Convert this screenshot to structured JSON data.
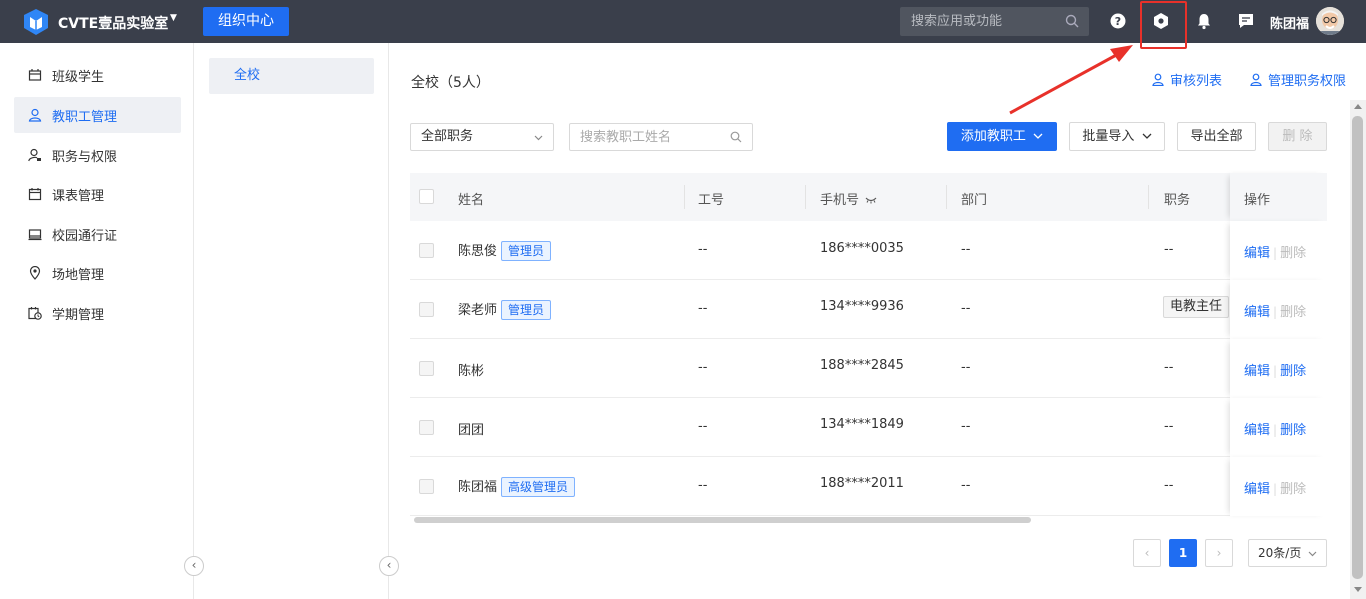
{
  "topbar": {
    "app_title": "CVTE壹品实验室",
    "org_button": "组织中心",
    "search_placeholder": "搜索应用或功能",
    "username": "陈团福",
    "bg_color": "#3a3f4b",
    "accent": "#1f6df2"
  },
  "sidenav": {
    "items": [
      {
        "label": "班级学生",
        "icon": "class-icon"
      },
      {
        "label": "教职工管理",
        "icon": "user-icon",
        "active": true
      },
      {
        "label": "职务与权限",
        "icon": "user-permission-icon"
      },
      {
        "label": "课表管理",
        "icon": "calendar-icon"
      },
      {
        "label": "校园通行证",
        "icon": "card-icon"
      },
      {
        "label": "场地管理",
        "icon": "location-icon"
      },
      {
        "label": "学期管理",
        "icon": "calendar-clock-icon"
      }
    ]
  },
  "tree": {
    "root": "全校"
  },
  "main": {
    "title": "全校（5人）",
    "links": {
      "review_list": "审核列表",
      "manage_permissions": "管理职务权限"
    },
    "filter_select": "全部职务",
    "search_placeholder": "搜索教职工姓名",
    "buttons": {
      "add": "添加教职工",
      "import": "批量导入",
      "export": "导出全部",
      "delete": "删 除"
    }
  },
  "table": {
    "headers": {
      "name": "姓名",
      "id": "工号",
      "phone": "手机号",
      "dept": "部门",
      "role": "职务",
      "ops": "操作"
    },
    "ops": {
      "edit": "编辑",
      "delete": "删除"
    },
    "rows": [
      {
        "name": "陈思俊",
        "tag": "管理员",
        "id": "--",
        "phone": "186****0035",
        "dept": "--",
        "role": "--",
        "deletable": false
      },
      {
        "name": "梁老师",
        "tag": "管理员",
        "id": "--",
        "phone": "134****9936",
        "dept": "--",
        "role": "电教主任",
        "deletable": false
      },
      {
        "name": "陈彬",
        "tag": "",
        "id": "--",
        "phone": "188****2845",
        "dept": "--",
        "role": "--",
        "deletable": true
      },
      {
        "name": "团团",
        "tag": "",
        "id": "--",
        "phone": "134****1849",
        "dept": "--",
        "role": "--",
        "deletable": true
      },
      {
        "name": "陈团福",
        "tag": "高级管理员",
        "id": "--",
        "phone": "188****2011",
        "dept": "--",
        "role": "--",
        "deletable": false
      }
    ]
  },
  "pagination": {
    "current": "1",
    "page_size": "20条/页"
  }
}
